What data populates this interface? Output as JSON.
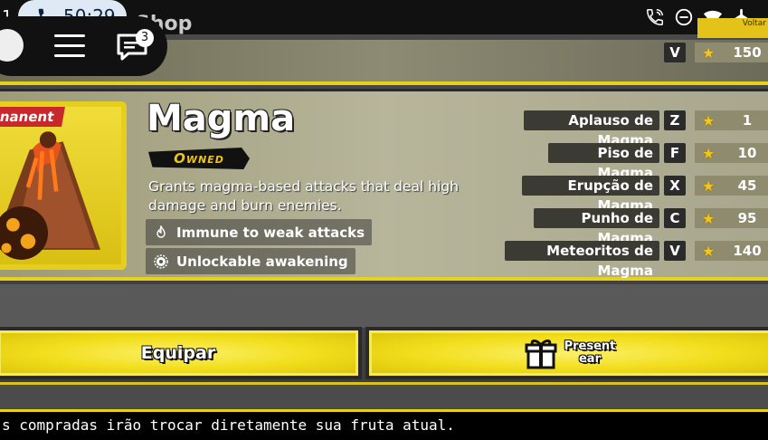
{
  "status_bar": {
    "clock_left": "1",
    "call_time": "50:29",
    "icons": [
      "wifi-call-icon",
      "do-not-disturb-icon",
      "wifi-icon",
      "airplane-icon"
    ]
  },
  "header": {
    "title": "Shop",
    "back_label": "Voltar",
    "chat_badge": "3",
    "icons": [
      "back-icon",
      "hamburger-menu-icon",
      "chat-icon"
    ]
  },
  "previous_item": {
    "key": "V",
    "price": "150"
  },
  "fruit": {
    "rarity": "Permanent",
    "rarity_visible": "nanent",
    "name": "Magma",
    "status": "Owned",
    "description": "Grants magma-based attacks that deal high damage and burn enemies.",
    "features": [
      {
        "icon": "flame-icon",
        "label": "Immune to weak attacks"
      },
      {
        "icon": "awaken-gear-icon",
        "label": "Unlockable awakening"
      }
    ]
  },
  "moves": [
    {
      "name": "Aplauso de Magma",
      "key": "Z",
      "price": "1"
    },
    {
      "name": "Piso de Magma",
      "key": "F",
      "price": "10"
    },
    {
      "name": "Erupção de Magma",
      "key": "X",
      "price": "45"
    },
    {
      "name": "Punho de Magma",
      "key": "C",
      "price": "95"
    },
    {
      "name": "Meteoritos de Magma",
      "key": "V",
      "price": "140"
    }
  ],
  "actions": {
    "equip_label": "Equipar",
    "present_label_1": "Present",
    "present_label_2": "ear"
  },
  "notice": "s compradas irão trocar diretamente sua fruta atual.",
  "colors": {
    "accent_yellow": "#e6d21c",
    "rarity_red": "#c8282c",
    "owned_text": "#f1c40f"
  }
}
